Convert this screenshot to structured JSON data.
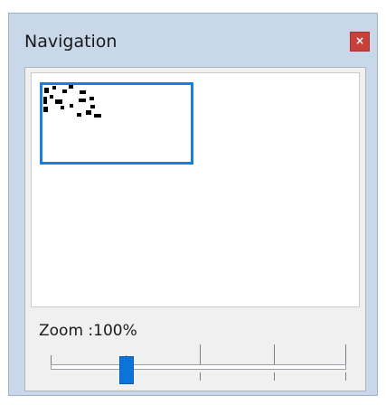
{
  "window": {
    "title": "Navigation",
    "close_label": "×"
  },
  "zoom": {
    "label": "Zoom :100%",
    "value_percent": 100,
    "slider_fraction": 0.25
  },
  "colors": {
    "accent": "#1a7ee0",
    "close_button": "#c8403a",
    "frame": "#c9d7ea"
  },
  "icons": {
    "close": "close-icon"
  }
}
